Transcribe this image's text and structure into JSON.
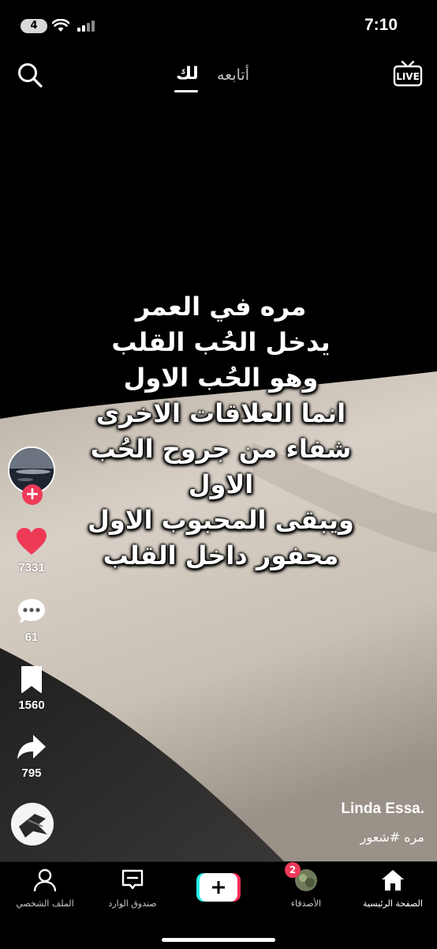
{
  "status": {
    "battery": "4",
    "time": "7:10"
  },
  "top_nav": {
    "following": "أتابعه",
    "for_you": "لك",
    "live": "LIVE"
  },
  "overlay_lines": [
    "مره في العمر",
    "يدخل الحُب القلب",
    "وهو الحُب الاول",
    "انما العلاقات الاخرى",
    "شفاء من جروح الحُب الاول",
    "ويبقى المحبوب الاول",
    "محفور داخل القلب"
  ],
  "actions": {
    "likes": "7331",
    "comments": "61",
    "saves": "1560",
    "shares": "795"
  },
  "caption": {
    "username": "Linda Essa.",
    "hashtags": "مره #شعور"
  },
  "bottom_nav": {
    "home": "الصفحة الرئيسية",
    "friends": "الأصدقاء",
    "friends_badge": "2",
    "inbox": "صندوق الوارد",
    "profile": "الملف الشخصي"
  },
  "colors": {
    "accent": "#ee3a57",
    "background": "#000000"
  }
}
